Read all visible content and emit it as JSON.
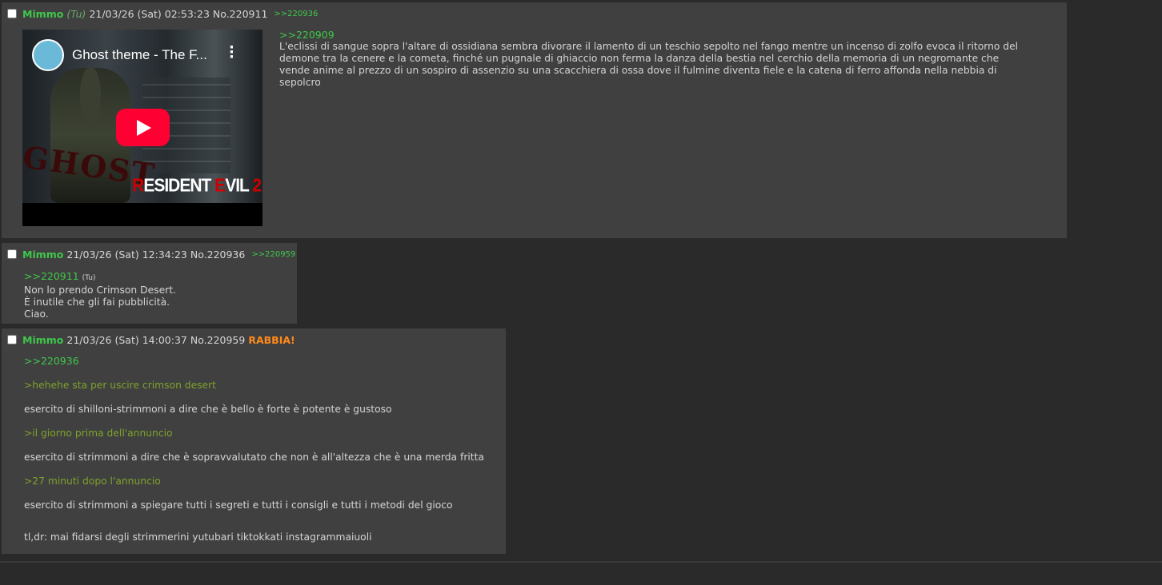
{
  "posts": [
    {
      "name": "Mimmo",
      "trip": "(Tu)",
      "date": "21/03/26 (Sat) 02:53:23",
      "number": "No.220911",
      "backlink": ">>220936",
      "embed": {
        "title": "Ghost theme - The F...",
        "overlay": "GHOST",
        "logo": "RESIDENT EVIL 2"
      },
      "quote": ">>220909",
      "text": "L'eclissi di sangue sopra l'altare di ossidiana sembra divorare il lamento di un teschio sepolto nel fango mentre un incenso di zolfo evoca il ritorno del demone tra la cenere e la cometa, finché un pugnale di ghiaccio non ferma la danza della bestia nel cerchio della memoria di un negromante che vende anime al prezzo di un sospiro di assenzio su una scacchiera di ossa dove il fulmine diventa fiele e la catena di ferro affonda nella nebbia di sepolcro"
    },
    {
      "name": "Mimmo",
      "date": "21/03/26 (Sat) 12:34:23",
      "number": "No.220936",
      "backlink": ">>220959",
      "quote": ">>220911",
      "you": "(Tu)",
      "lines": [
        "Non lo prendo Crimson Desert.",
        "È inutile che gli fai pubblicità.",
        "Ciao."
      ]
    },
    {
      "name": "Mimmo",
      "date": "21/03/26 (Sat) 14:00:37",
      "number": "No.220959",
      "tag": "RABBIA!",
      "quote": ">>220936",
      "lines": [
        ">hehehe sta per uscire crimson desert",
        "esercito di shilloni-strimmoni a dire che è bello è forte è potente è gustoso",
        ">il giorno prima dell'annuncio",
        "esercito di strimmoni a dire che è sopravvalutato che non è all'altezza che è una merda fritta",
        ">27 minuti dopo l'annuncio",
        "esercito di strimmoni a spiegare tutti i segreti e tutti i consigli e tutti i metodi del gioco",
        "",
        "tl,dr: mai fidarsi degli strimmerini yutubari tiktokkati instagrammaiuoli"
      ]
    }
  ]
}
